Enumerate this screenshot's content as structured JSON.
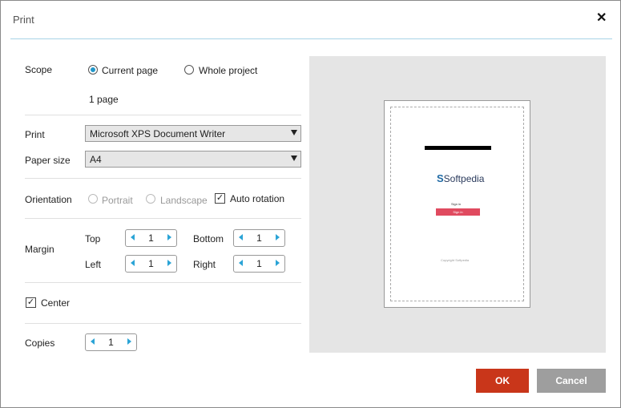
{
  "dialog": {
    "title": "Print",
    "close_symbol": "✕"
  },
  "scope": {
    "label": "Scope",
    "options": [
      {
        "label": "Current page",
        "selected": true
      },
      {
        "label": "Whole project",
        "selected": false
      }
    ],
    "page_count": "1 page"
  },
  "printer": {
    "label": "Print",
    "value": "Microsoft XPS Document Writer"
  },
  "paper": {
    "label": "Paper size",
    "value": "A4"
  },
  "orientation": {
    "label": "Orientation",
    "portrait": "Portrait",
    "landscape": "Landscape",
    "auto_rotation": "Auto rotation",
    "auto_rotation_checked": true
  },
  "margin": {
    "label": "Margin",
    "top": {
      "label": "Top",
      "value": "1"
    },
    "bottom": {
      "label": "Bottom",
      "value": "1"
    },
    "left": {
      "label": "Left",
      "value": "1"
    },
    "right": {
      "label": "Right",
      "value": "1"
    }
  },
  "center": {
    "label": "Center",
    "checked": true
  },
  "copies": {
    "label": "Copies",
    "value": "1"
  },
  "preview": {
    "logo_mark": "S",
    "logo_text": "Softpedia",
    "signin_text": "Sign in",
    "button_text": "Sign in",
    "footer_text": "Copyright Softpedia"
  },
  "buttons": {
    "ok": "OK",
    "cancel": "Cancel"
  },
  "colors": {
    "accent": "#2ba4d6",
    "ok_button": "#c9361a",
    "cancel_button": "#9e9e9e",
    "preview_bg": "#e5e5e5"
  }
}
